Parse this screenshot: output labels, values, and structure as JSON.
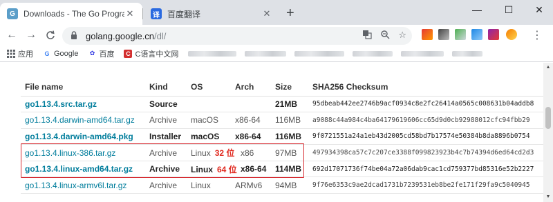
{
  "browser": {
    "tabs": [
      {
        "title": "Downloads - The Go Programm",
        "favicon": "go-gopher-icon",
        "active": true
      },
      {
        "title": "百度翻译",
        "favicon": "baidu-translate-icon",
        "active": false
      }
    ],
    "new_tab": "+",
    "window_controls": {
      "minimize": "—",
      "maximize": "☐",
      "close": "✕"
    }
  },
  "toolbar": {
    "url_host": "golang.google.cn",
    "url_path": "/dl/",
    "nav_back": "←",
    "nav_forward": "→",
    "nav_reload": "C"
  },
  "bookmarks": [
    {
      "label": "应用",
      "icon": "apps-grid-icon"
    },
    {
      "label": "Google",
      "icon": "google-icon"
    },
    {
      "label": "百度",
      "icon": "baidu-icon"
    },
    {
      "label": "C语言中文网",
      "icon": "c-lang-icon"
    }
  ],
  "downloads_table": {
    "headers": [
      "File name",
      "Kind",
      "OS",
      "Arch",
      "Size",
      "SHA256 Checksum"
    ],
    "rows": [
      {
        "file": "go1.13.4.src.tar.gz",
        "kind": "Source",
        "os": "",
        "arch": "",
        "size": "21MB",
        "sha": "95dbeab442ee2746b9acf0934c8e2fc26414a0565c008631b04addb8",
        "bold": true,
        "note": ""
      },
      {
        "file": "go1.13.4.darwin-amd64.tar.gz",
        "kind": "Archive",
        "os": "macOS",
        "arch": "x86-64",
        "size": "116MB",
        "sha": "a9088c44a984c4ba64179619606cc65d9d0cb92988012cfc94fbb29",
        "bold": false,
        "note": ""
      },
      {
        "file": "go1.13.4.darwin-amd64.pkg",
        "kind": "Installer",
        "os": "macOS",
        "arch": "x86-64",
        "size": "116MB",
        "sha": "9f0721551a24a1eb43d2005cd58bd7b17574e50384b8da8896b0754",
        "bold": true,
        "note": ""
      },
      {
        "file": "go1.13.4.linux-386.tar.gz",
        "kind": "Archive",
        "os": "Linux",
        "arch": "x86",
        "size": "97MB",
        "sha": "497934398ca57c7c207ce3388f099823923b4c7b74394d6ed64cd2d3",
        "bold": false,
        "note": "32 位"
      },
      {
        "file": "go1.13.4.linux-amd64.tar.gz",
        "kind": "Archive",
        "os": "Linux",
        "arch": "x86-64",
        "size": "114MB",
        "sha": "692d17071736f74be04a72a06dab9cac1cd759377bd85316e52b2227",
        "bold": true,
        "note": "64 位"
      },
      {
        "file": "go1.13.4.linux-armv6l.tar.gz",
        "kind": "Archive",
        "os": "Linux",
        "arch": "ARMv6",
        "size": "94MB",
        "sha": "9f76e6353c9ae2dcad1731b7239531eb8be2fe171f29fa9c5040945",
        "bold": false,
        "note": ""
      }
    ]
  },
  "colors": {
    "annotation_red": "#d6282e",
    "link_blue": "#007d9c"
  }
}
